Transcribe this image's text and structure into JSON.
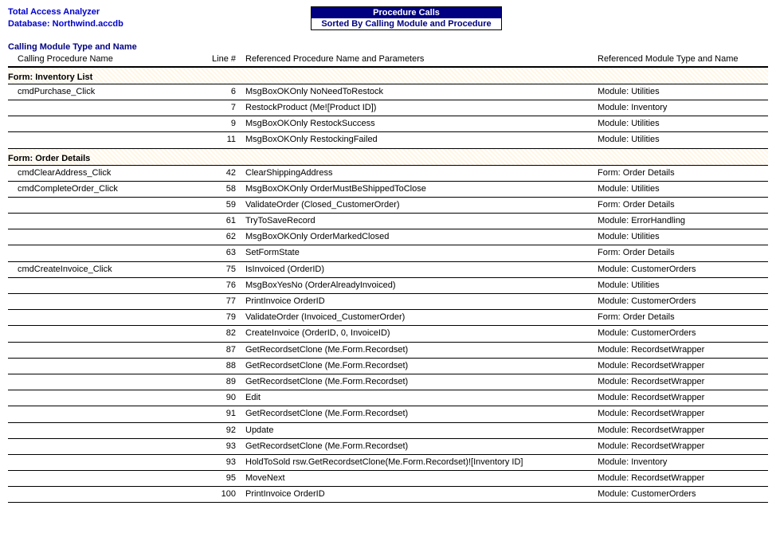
{
  "app": {
    "name": "Total Access Analyzer",
    "database_label": "Database:",
    "database_name": "Northwind.accdb"
  },
  "report": {
    "title": "Procedure Calls",
    "subtitle": "Sorted By Calling Module and Procedure"
  },
  "section_label": "Calling Module Type and Name",
  "columns": {
    "proc": "Calling Procedure Name",
    "line": "Line #",
    "ref": "Referenced Procedure Name and Parameters",
    "mod": "Referenced Module Type and Name"
  },
  "groups": [
    {
      "header": "Form: Inventory List",
      "rows": [
        {
          "proc": "cmdPurchase_Click",
          "line": "6",
          "ref": "MsgBoxOKOnly NoNeedToRestock",
          "mod": "Module: Utilities"
        },
        {
          "proc": "",
          "line": "7",
          "ref": "RestockProduct (Me![Product ID])",
          "mod": "Module: Inventory"
        },
        {
          "proc": "",
          "line": "9",
          "ref": "MsgBoxOKOnly RestockSuccess",
          "mod": "Module: Utilities"
        },
        {
          "proc": "",
          "line": "11",
          "ref": "MsgBoxOKOnly RestockingFailed",
          "mod": "Module: Utilities"
        }
      ]
    },
    {
      "header": "Form: Order Details",
      "rows": [
        {
          "proc": "cmdClearAddress_Click",
          "line": "42",
          "ref": "ClearShippingAddress",
          "mod": "Form: Order Details"
        },
        {
          "proc": "cmdCompleteOrder_Click",
          "line": "58",
          "ref": "MsgBoxOKOnly OrderMustBeShippedToClose",
          "mod": "Module: Utilities"
        },
        {
          "proc": "",
          "line": "59",
          "ref": "ValidateOrder (Closed_CustomerOrder)",
          "mod": "Form: Order Details"
        },
        {
          "proc": "",
          "line": "61",
          "ref": "TryToSaveRecord",
          "mod": "Module: ErrorHandling"
        },
        {
          "proc": "",
          "line": "62",
          "ref": "MsgBoxOKOnly OrderMarkedClosed",
          "mod": "Module: Utilities"
        },
        {
          "proc": "",
          "line": "63",
          "ref": "SetFormState",
          "mod": "Form: Order Details"
        },
        {
          "proc": "cmdCreateInvoice_Click",
          "line": "75",
          "ref": "IsInvoiced (OrderID)",
          "mod": "Module: CustomerOrders"
        },
        {
          "proc": "",
          "line": "76",
          "ref": "MsgBoxYesNo (OrderAlreadyInvoiced)",
          "mod": "Module: Utilities"
        },
        {
          "proc": "",
          "line": "77",
          "ref": "PrintInvoice OrderID",
          "mod": "Module: CustomerOrders"
        },
        {
          "proc": "",
          "line": "79",
          "ref": "ValidateOrder (Invoiced_CustomerOrder)",
          "mod": "Form: Order Details"
        },
        {
          "proc": "",
          "line": "82",
          "ref": "CreateInvoice (OrderID, 0, InvoiceID)",
          "mod": "Module: CustomerOrders"
        },
        {
          "proc": "",
          "line": "87",
          "ref": "GetRecordsetClone (Me.Form.Recordset)",
          "mod": "Module: RecordsetWrapper"
        },
        {
          "proc": "",
          "line": "88",
          "ref": "GetRecordsetClone (Me.Form.Recordset)",
          "mod": "Module: RecordsetWrapper"
        },
        {
          "proc": "",
          "line": "89",
          "ref": "GetRecordsetClone (Me.Form.Recordset)",
          "mod": "Module: RecordsetWrapper"
        },
        {
          "proc": "",
          "line": "90",
          "ref": "Edit",
          "mod": "Module: RecordsetWrapper"
        },
        {
          "proc": "",
          "line": "91",
          "ref": "GetRecordsetClone (Me.Form.Recordset)",
          "mod": "Module: RecordsetWrapper"
        },
        {
          "proc": "",
          "line": "92",
          "ref": "Update",
          "mod": "Module: RecordsetWrapper"
        },
        {
          "proc": "",
          "line": "93",
          "ref": "GetRecordsetClone (Me.Form.Recordset)",
          "mod": "Module: RecordsetWrapper"
        },
        {
          "proc": "",
          "line": "93",
          "ref": "HoldToSold rsw.GetRecordsetClone(Me.Form.Recordset)![Inventory ID]",
          "mod": "Module: Inventory"
        },
        {
          "proc": "",
          "line": "95",
          "ref": "MoveNext",
          "mod": "Module: RecordsetWrapper"
        },
        {
          "proc": "",
          "line": "100",
          "ref": "PrintInvoice OrderID",
          "mod": "Module: CustomerOrders"
        }
      ]
    }
  ]
}
